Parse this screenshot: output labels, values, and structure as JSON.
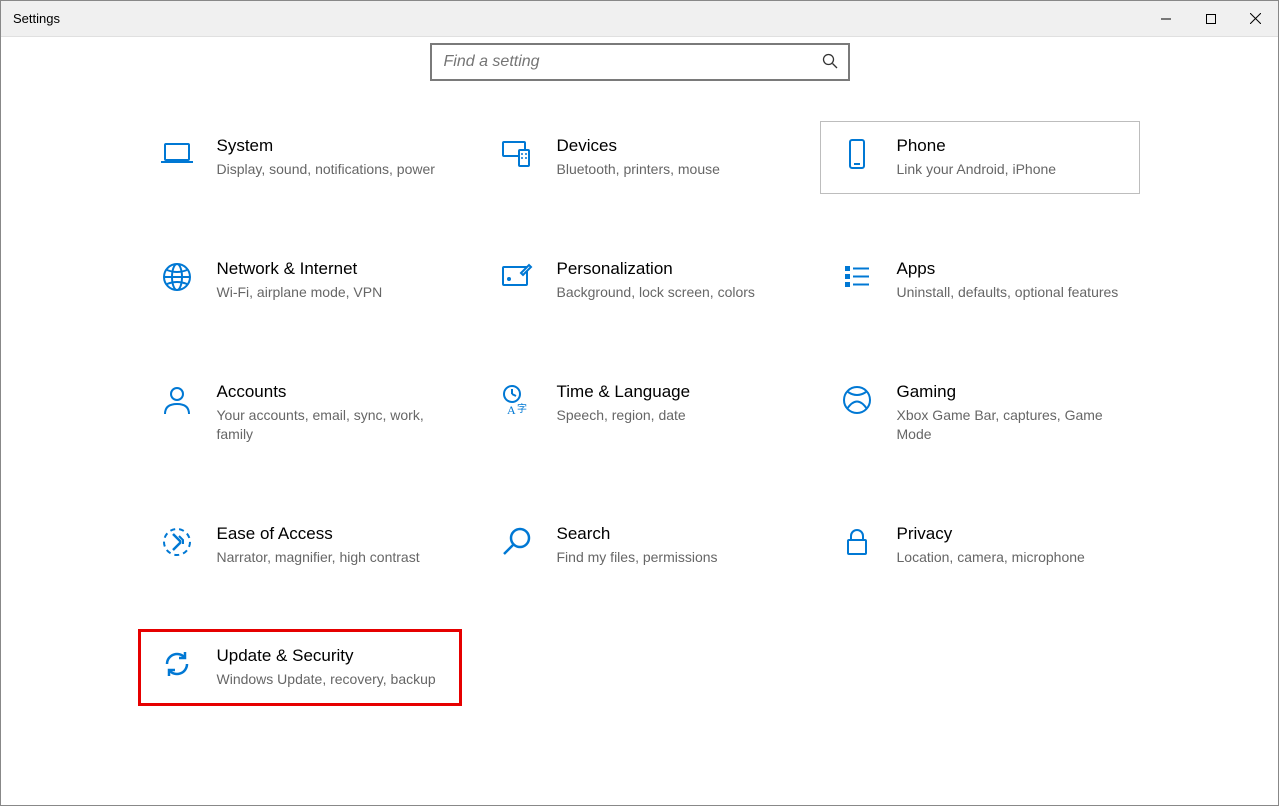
{
  "window": {
    "title": "Settings"
  },
  "search": {
    "placeholder": "Find a setting"
  },
  "tiles": {
    "system": {
      "title": "System",
      "sub": "Display, sound, notifications, power"
    },
    "devices": {
      "title": "Devices",
      "sub": "Bluetooth, printers, mouse"
    },
    "phone": {
      "title": "Phone",
      "sub": "Link your Android, iPhone"
    },
    "network": {
      "title": "Network & Internet",
      "sub": "Wi-Fi, airplane mode, VPN"
    },
    "personalization": {
      "title": "Personalization",
      "sub": "Background, lock screen, colors"
    },
    "apps": {
      "title": "Apps",
      "sub": "Uninstall, defaults, optional features"
    },
    "accounts": {
      "title": "Accounts",
      "sub": "Your accounts, email, sync, work, family"
    },
    "time": {
      "title": "Time & Language",
      "sub": "Speech, region, date"
    },
    "gaming": {
      "title": "Gaming",
      "sub": "Xbox Game Bar, captures, Game Mode"
    },
    "ease": {
      "title": "Ease of Access",
      "sub": "Narrator, magnifier, high contrast"
    },
    "search_cat": {
      "title": "Search",
      "sub": "Find my files, permissions"
    },
    "privacy": {
      "title": "Privacy",
      "sub": "Location, camera, microphone"
    },
    "update": {
      "title": "Update & Security",
      "sub": "Windows Update, recovery, backup"
    }
  }
}
